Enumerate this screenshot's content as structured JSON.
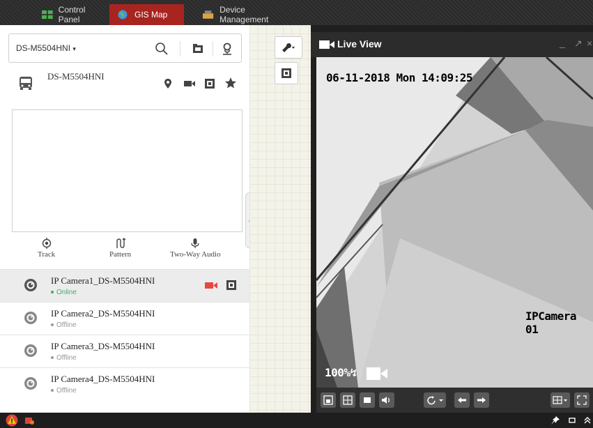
{
  "tabs": [
    {
      "label": "Control Panel",
      "icon": "grid-icon"
    },
    {
      "label": "GIS Map",
      "icon": "globe-icon",
      "active": true
    },
    {
      "label": "Device Management",
      "icon": "device-icon"
    }
  ],
  "left": {
    "device_select": "DS-M5504HNI",
    "device_name": "DS-M5504HNI",
    "ptz": {
      "track": "Track",
      "pattern": "Pattern",
      "two_way_audio": "Two-Way Audio"
    },
    "cameras": [
      {
        "name": "IP Camera1_DS-M5504HNI",
        "status": "Online"
      },
      {
        "name": "IP Camera2_DS-M5504HNI",
        "status": "Offline"
      },
      {
        "name": "IP Camera3_DS-M5504HNI",
        "status": "Offline"
      },
      {
        "name": "IP Camera4_DS-M5504HNI",
        "status": "Offline"
      }
    ]
  },
  "live": {
    "title": "Live View",
    "osd_datetime": "06-11-2018 Mon 14:09:25",
    "osd_camera": "IPCamera 01",
    "osd_zoom": "100%"
  },
  "colors": {
    "accent": "#a8241f",
    "online": "#3bb34a",
    "record": "#e8473f"
  }
}
